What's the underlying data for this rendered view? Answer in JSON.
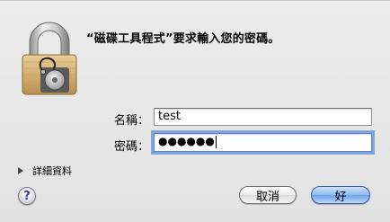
{
  "dialog": {
    "message": "“磁碟工具程式”要求輸入您的密碼。",
    "lock_icon": "padlock-with-disk-utility-icon"
  },
  "fields": {
    "name_label": "名稱：",
    "name_value": "test",
    "password_label": "密碼：",
    "password_value": "●●●●●●"
  },
  "details": {
    "label": "詳細資料",
    "icon": "disclosure-triangle-right-icon"
  },
  "help": {
    "label": "?"
  },
  "buttons": {
    "cancel": "取消",
    "ok": "好"
  },
  "colors": {
    "focus_ring": "#7ea6dc",
    "default_button": "#8db9ee",
    "background": "#e8e8e8"
  }
}
